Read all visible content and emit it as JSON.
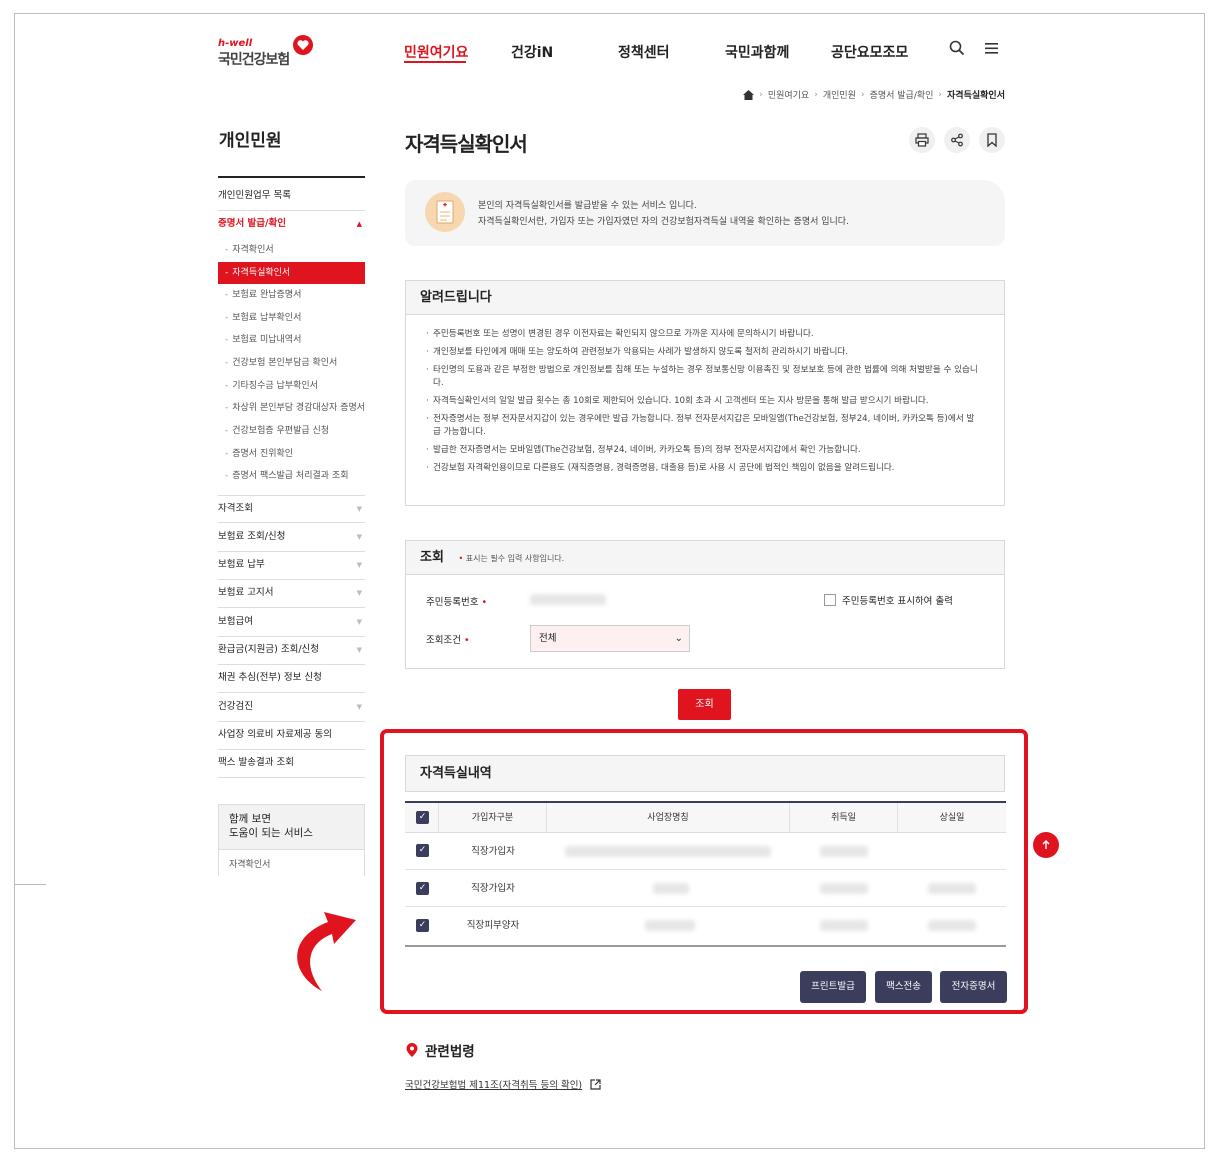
{
  "header": {
    "logo_brand": "h-well",
    "logo_name": "국민건강보험",
    "nav": [
      "민원여기요",
      "건강iN",
      "정책센터",
      "국민과함께",
      "공단요모조모"
    ],
    "active_nav": "민원여기요"
  },
  "breadcrumb": [
    "민원여기요",
    "개인민원",
    "증명서 발급/확인",
    "자격득실확인서"
  ],
  "sidebar": {
    "title": "개인민원",
    "items_top": [
      {
        "label": "개인민원업무 목록"
      },
      {
        "label": "증명서 발급/확인",
        "open": true
      }
    ],
    "sub_items": [
      {
        "label": "자격확인서"
      },
      {
        "label": "자격득실확인서",
        "active": true
      },
      {
        "label": "보험료 완납증명서"
      },
      {
        "label": "보험료 납부확인서"
      },
      {
        "label": "보험료 미납내역서"
      },
      {
        "label": "건강보험 본인부담금 확인서"
      },
      {
        "label": "기타징수금 납부확인서"
      },
      {
        "label": "차상위 본인부담 경감대상자 증명서"
      },
      {
        "label": "건강보험증 우편발급 신청"
      },
      {
        "label": "증명서 진위확인"
      },
      {
        "label": "증명서 팩스발급 처리결과 조회"
      }
    ],
    "items_bottom": [
      {
        "label": "자격조회",
        "caret": true
      },
      {
        "label": "보험료 조회/신청",
        "caret": true
      },
      {
        "label": "보험료 납부",
        "caret": true
      },
      {
        "label": "보험료 고지서",
        "caret": true
      },
      {
        "label": "보험급여",
        "caret": true
      },
      {
        "label": "환급금(지원금) 조회/신청",
        "caret": true
      },
      {
        "label": "채권 추심(전부) 정보 신청",
        "caret": false
      },
      {
        "label": "건강검진",
        "caret": true
      },
      {
        "label": "사업장 의료비 자료제공 동의",
        "caret": false
      },
      {
        "label": "팩스 발송결과 조회",
        "caret": false
      }
    ],
    "together": {
      "line1": "함께 보면",
      "line2": "도움이 되는 서비스",
      "link": "자격확인서"
    }
  },
  "main": {
    "title": "자격득실확인서",
    "intro": {
      "line1": "본인의 자격득실확인서를 발급받을 수 있는 서비스 입니다.",
      "line2": "자격득실확인서란, 가입자 또는 가입자였던 자의 건강보험자격득실 내역을 확인하는 증명서 입니다."
    },
    "notice": {
      "title": "알려드립니다",
      "items": [
        "주민등록번호 또는 성명이 변경된 경우 이전자료는 확인되지 않으므로 가까운 지사에 문의하시기 바랍니다.",
        "개인정보를 타인에게 매매 또는 양도하여 관련정보가 악용되는 사례가 발생하지 않도록 철저히 관리하시기 바랍니다.",
        "타인명의 도용과 같은 부정한 방법으로 개인정보를 침해 또는 누설하는 경우 정보통신망 이용촉진 및 정보보호 등에 관한 법률에 의해 처벌받을 수 있습니다.",
        "자격득실확인서의 일일 발급 횟수는 총 10회로 제한되어 있습니다. 10회 초과 시 고객센터 또는 지사 방문을 통해 발급 받으시기 바랍니다.",
        "전자증명서는 정부 전자문서지갑이 있는 경우에만 발급 가능합니다. 정부 전자문서지갑은 모바일앱(The건강보험, 정부24, 네이버, 카카오톡 등)에서 발급 가능합니다.",
        "발급한 전자증명서는 모바일앱(The건강보험, 정부24, 네이버, 카카오톡 등)의 정부 전자문서지갑에서 확인 가능합니다.",
        "건강보험 자격확인용이므로 다른용도 (재직증명용, 경력증명용, 대출용 등)로 사용 시 공단에 법적인 책임이 없음을 알려드립니다."
      ]
    },
    "query": {
      "title": "조회",
      "required_note": "표시는 필수 입력 사항입니다.",
      "rrn_label": "주민등록번호",
      "print_rrn_label": "주민등록번호 표시하여 출력",
      "condition_label": "조회조건",
      "condition_value": "전체",
      "submit": "조회"
    },
    "history": {
      "title": "자격득실내역",
      "columns": [
        "가입자구분",
        "사업장명칭",
        "취득일",
        "상실일"
      ],
      "rows": [
        {
          "type": "직장가입자"
        },
        {
          "type": "직장가입자"
        },
        {
          "type": "직장피부양자"
        }
      ],
      "buttons": [
        "프린트발급",
        "팩스전송",
        "전자증명서"
      ]
    },
    "law": {
      "title": "관련법령",
      "link": "국민건강보험법 제11조(자격취득 등의 확인)"
    }
  },
  "colors": {
    "accent": "#e0141e",
    "navy": "#3a3d5c"
  }
}
